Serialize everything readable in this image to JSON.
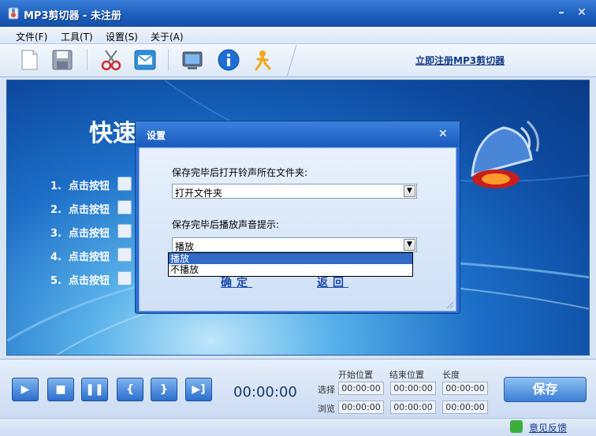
{
  "window": {
    "title": "MP3剪切器 - 未注册",
    "minimize": "–",
    "close": "✕"
  },
  "menu": [
    "文件(F)",
    "工具(T)",
    "设置(S)",
    "关于(A)"
  ],
  "toolbar": {
    "register_link": "立即注册MP3剪切器",
    "icons": [
      "new-file-icon",
      "save-icon",
      "scissors-icon",
      "mail-icon",
      "monitor-icon",
      "info-icon",
      "person-icon"
    ]
  },
  "content": {
    "title": "快速开始",
    "steps": [
      {
        "num": "1.",
        "label": "点击按钮"
      },
      {
        "num": "2.",
        "label": "点击按钮"
      },
      {
        "num": "3.",
        "label": "点击按钮"
      },
      {
        "num": "4.",
        "label": "点击按钮"
      },
      {
        "num": "5.",
        "label": "点击按钮"
      }
    ]
  },
  "dialog": {
    "title": "设置",
    "close": "✕",
    "label1": "保存完毕后打开铃声所在文件夹:",
    "select1_value": "打开文件夹",
    "label2": "保存完毕后播放声音提示:",
    "select2_value": "播放",
    "options": [
      "播放",
      "不播放"
    ],
    "ok": "确定",
    "back": "返回"
  },
  "player": {
    "time": "00:00:00",
    "col_start": "开始位置",
    "col_end": "结束位置",
    "col_length": "长度",
    "row_select": "选择",
    "row_browse": "浏览",
    "select_start": "00:00:00",
    "select_end": "00:00:00",
    "select_length": "00:00:00",
    "browse_start": "00:00:00",
    "browse_end": "00:00:00",
    "browse_length": "00:00:00",
    "save": "保存"
  },
  "status": {
    "feedback": "意见反馈"
  },
  "colors": {
    "title_blue": "#1d5fbe",
    "dialog_blue": "#2b6fd4",
    "selection": "#316ac5"
  }
}
